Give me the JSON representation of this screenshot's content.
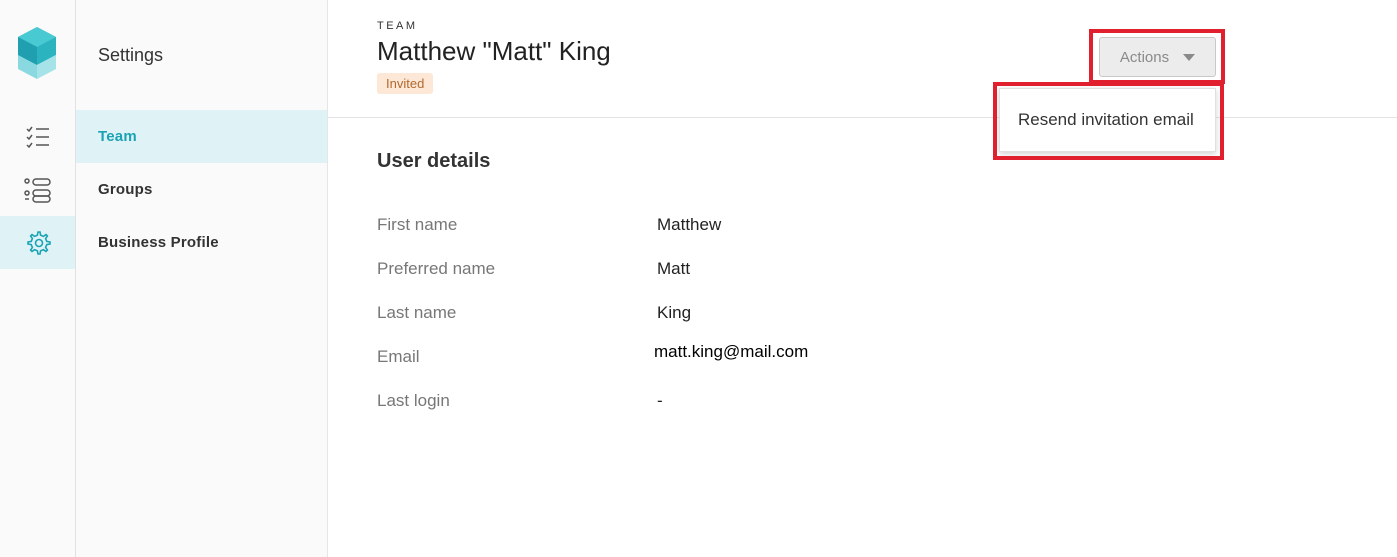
{
  "nav": {
    "rail": [
      {
        "icon": "checklist-icon"
      },
      {
        "icon": "toggles-list-icon"
      },
      {
        "icon": "gear-icon",
        "active": true
      }
    ],
    "settings_title": "Settings",
    "items": [
      {
        "label": "Team",
        "active": true
      },
      {
        "label": "Groups"
      },
      {
        "label": "Business Profile"
      }
    ]
  },
  "header": {
    "eyebrow": "TEAM",
    "title": "Matthew \"Matt\" King",
    "status": "Invited",
    "actions_label": "Actions"
  },
  "actions_menu": {
    "items": [
      {
        "label": "Resend invitation email"
      }
    ]
  },
  "details": {
    "title": "User details",
    "fields": [
      {
        "label": "First name",
        "value": "Matthew"
      },
      {
        "label": "Preferred name",
        "value": "Matt"
      },
      {
        "label": "Last name",
        "value": "King"
      },
      {
        "label": "Email",
        "value": "matt.king@mail.com"
      },
      {
        "label": "Last login",
        "value": "-"
      }
    ]
  },
  "colors": {
    "accent": "#1aa3b4",
    "active_bg": "#dff3f6",
    "badge_bg": "#fde7d7",
    "badge_text": "#b36a2e",
    "highlight": "#e0202e"
  }
}
